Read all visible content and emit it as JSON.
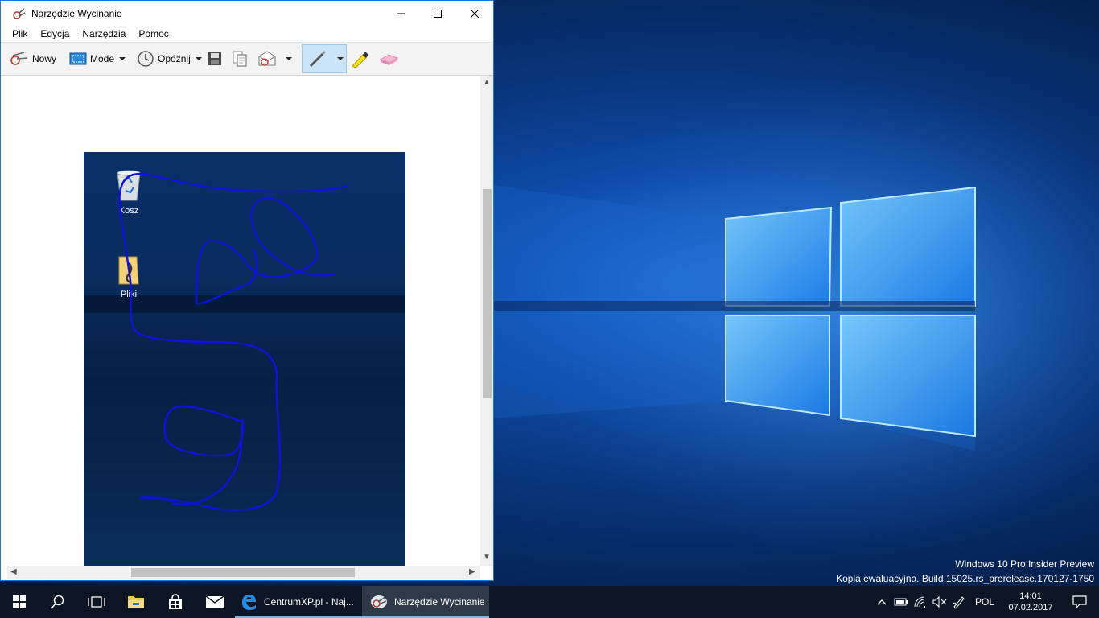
{
  "window": {
    "title": "Narzędzie Wycinanie",
    "menu": [
      "Plik",
      "Edycja",
      "Narzędzia",
      "Pomoc"
    ],
    "toolbar": {
      "new_label": "Nowy",
      "mode_label": "Mode",
      "delay_label": "Opóźnij"
    },
    "snip": {
      "icons": [
        {
          "label": "Kosz",
          "icon": "recycle-bin-icon"
        },
        {
          "label": "Pliki",
          "icon": "folder-icon"
        }
      ],
      "pen_color": "#0f14d4"
    }
  },
  "desktop": {
    "watermark_line1": "Windows 10 Pro Insider Preview",
    "watermark_line2": "Kopia ewaluacyjna. Build 15025.rs_prerelease.170127-1750"
  },
  "taskbar": {
    "apps": [
      {
        "label": "CentrumXP.pl - Naj...",
        "icon": "edge-icon"
      },
      {
        "label": "Narzędzie Wycinanie",
        "icon": "snipping-tool-icon"
      }
    ],
    "language": "POL",
    "time": "14:01",
    "date": "07.02.2017",
    "accent": "#76b9ed"
  }
}
